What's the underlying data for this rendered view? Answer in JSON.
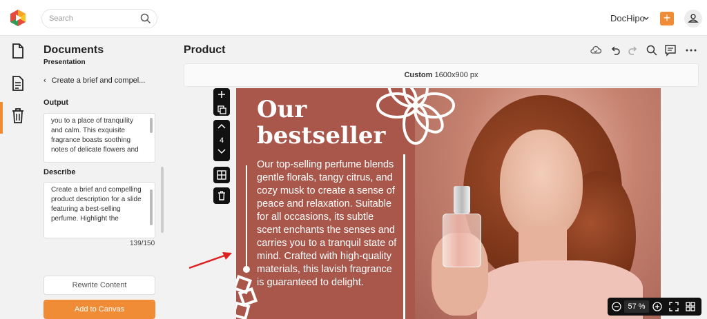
{
  "app": {
    "search_placeholder": "Search",
    "brand": "DocHipo",
    "add_label": "+"
  },
  "rail": {
    "items": [
      "document-icon",
      "template-text-icon",
      "trash-icon"
    ],
    "active_index": 1
  },
  "panel": {
    "title": "Documents",
    "subtitle": "Presentation",
    "back_label": "Create a brief and compel...",
    "output_label": "Output",
    "output_text": "you to a place of tranquility and calm. This exquisite fragrance boasts soothing notes of delicate flowers and",
    "describe_label": "Describe",
    "describe_text": "Create a brief and compelling product description for a  slide featuring a best-selling perfume. Highlight the",
    "char_count": "139/150",
    "rewrite_label": "Rewrite Content",
    "add_label": "Add to Canvas"
  },
  "main": {
    "title": "Product",
    "size_label": "Custom",
    "size_value": "1600x900 px",
    "slide_number": "4",
    "zoom_value": "57",
    "zoom_unit": "%"
  },
  "slide": {
    "heading_line1": "Our",
    "heading_line2": "bestseller",
    "body": "Our top-selling perfume blends gentle florals, tangy citrus, and cozy musk to create a sense of peace and relaxation. Suitable for all occasions, its subtle scent enchants the senses and carries you to a tranquil state of mind. Crafted with high-quality materials, this lavish fragrance is guaranteed to delight."
  },
  "colors": {
    "accent": "#f08b36",
    "slide_bg": "#a9574b",
    "annotation_arrow": "#e02020"
  }
}
